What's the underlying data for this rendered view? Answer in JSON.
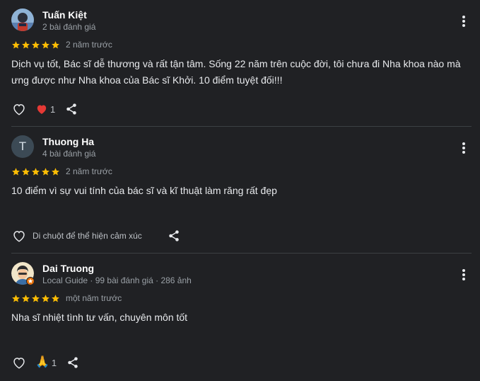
{
  "reviews": [
    {
      "name": "Tuấn Kiệt",
      "meta": "2 bài đánh giá",
      "stars": 5,
      "time": "2 năm trước",
      "text": "Dịch vụ tốt, Bác sĩ dễ thương và rất tận tâm. Sống 22 năm trên cuộc đời, tôi chưa đi Nha khoa nào mà ưng được như Nha khoa của Bác sĩ Khởi. 10 điểm tuyệt đối!!!",
      "reaction_emoji": "❤️",
      "reaction_count": "1",
      "avatar": "photo-avatar"
    },
    {
      "name": "Thuong Ha",
      "meta": "4 bài đánh giá",
      "stars": 5,
      "time": "2 năm trước",
      "text": "10 điểm vì sự vui tính của bác sĩ và kĩ thuật làm răng rất đẹp",
      "hover_hint": "Di chuột để thể hiện cảm xúc",
      "avatar_letter": "T"
    },
    {
      "name": "Dai Truong",
      "meta": "Local Guide · 99 bài đánh giá · 286 ảnh",
      "stars": 5,
      "time": "một năm trước",
      "text": "Nha sĩ nhiệt tình tư vấn, chuyên môn tốt",
      "reaction_emoji": "🙏",
      "reaction_count": "1",
      "avatar": "cartoon-avatar"
    }
  ],
  "colors": {
    "background": "#202124",
    "star": "#fbbc04",
    "divider": "#3c4043",
    "heart_reaction": "#e53935"
  },
  "icons": [
    "like-icon",
    "share-icon",
    "more-vert-icon",
    "star-icon",
    "local-guide-badge-icon"
  ]
}
